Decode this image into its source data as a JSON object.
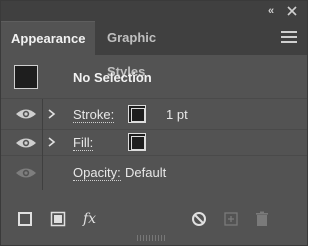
{
  "panel": {
    "tabs": [
      {
        "label": "Appearance",
        "active": true
      },
      {
        "label": "Graphic Styles",
        "active": false
      }
    ],
    "collapse_glyph": "«",
    "selection_label": "No Selection",
    "rows": {
      "stroke": {
        "label": "Stroke:",
        "value": "1 pt"
      },
      "fill": {
        "label": "Fill:"
      },
      "opacity": {
        "label": "Opacity:",
        "value": "Default"
      }
    },
    "icons": {
      "collapse": "double-chevron-left-icon",
      "close": "close-icon",
      "menu": "hamburger-menu-icon",
      "visibility": "eye-icon",
      "expand": "chevron-right-icon",
      "add_stroke": "add-new-stroke-icon",
      "add_fill": "add-new-fill-icon",
      "fx": "fx-icon",
      "clear": "clear-appearance-icon",
      "duplicate": "duplicate-item-icon",
      "delete": "trash-icon"
    },
    "fx_label": "fx",
    "colors": {
      "panel_bg": "#535353",
      "tab_bar_bg": "#404040",
      "text": "#f2f2f2",
      "muted_text": "#c0c0c0",
      "swatch": "#1e1e1e"
    }
  }
}
